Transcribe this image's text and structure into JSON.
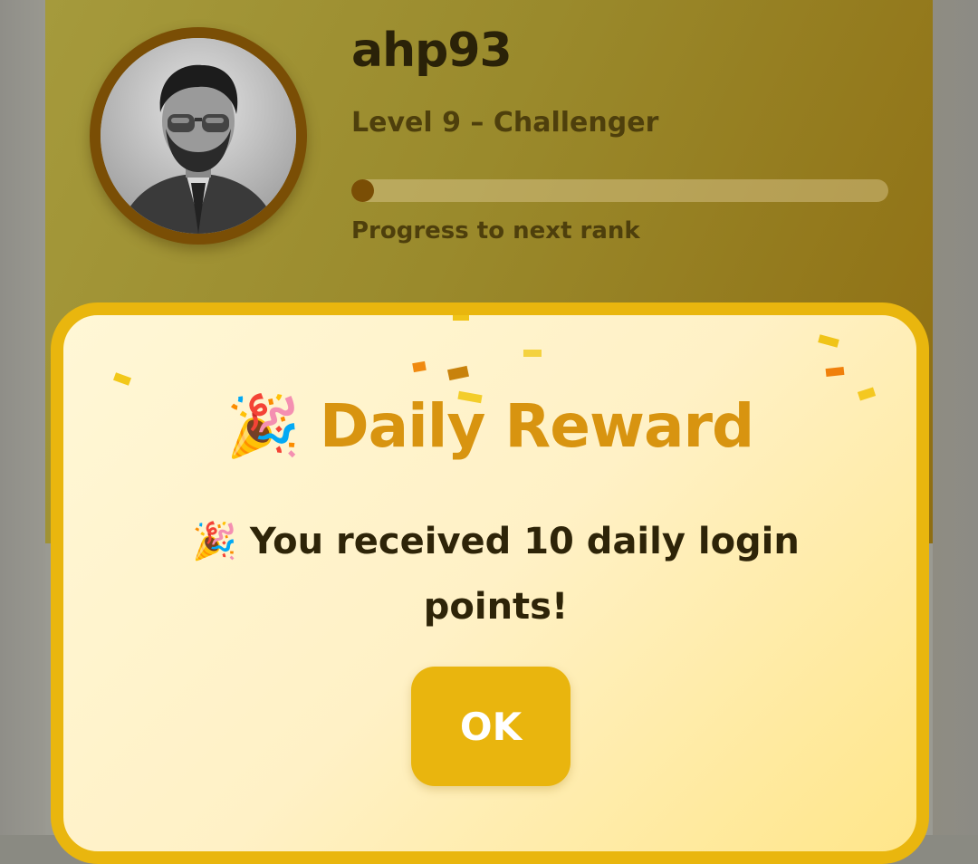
{
  "profile": {
    "username": "ahp93",
    "level_text": "Level 9 – Challenger",
    "progress_caption": "Progress to next rank",
    "progress_fraction": 0.02,
    "avatar_alt": "user-avatar"
  },
  "modal": {
    "title_emoji": "🎉",
    "title": "Daily Reward",
    "message_emoji": "🎉",
    "message": "You received 10 daily login points!",
    "ok_label": "OK"
  },
  "colors": {
    "accent": "#e9b60e",
    "title": "#d89410",
    "ring": "#7a4e05"
  }
}
